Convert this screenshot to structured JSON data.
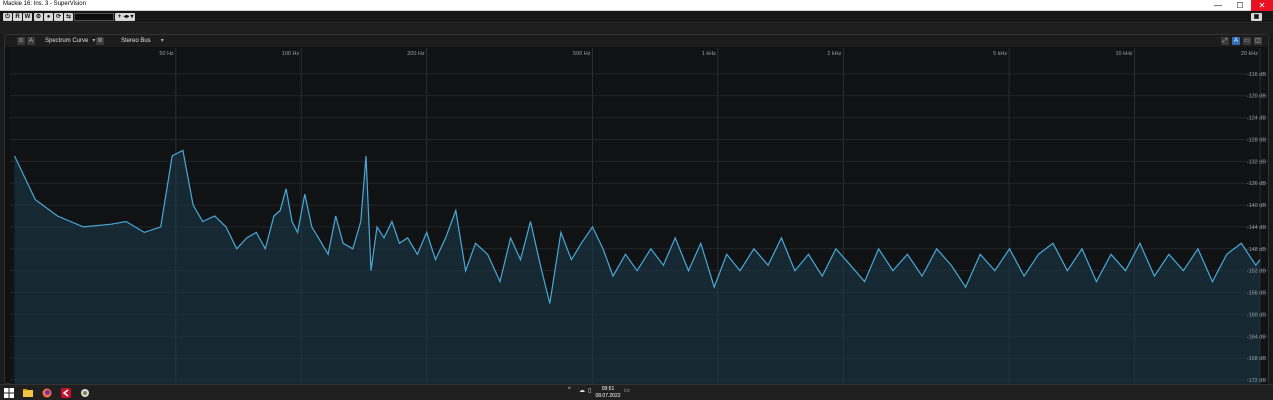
{
  "window": {
    "title": "Mackie 16: Ins. 3 - SuperVision",
    "minimize": "—",
    "maximize": "☐",
    "close": "✕"
  },
  "toolbar": {
    "power": "⏻",
    "read": "R",
    "write": "W",
    "settings": "⚙",
    "rec": "●",
    "preset_browser": "⟳",
    "compare": "⇆",
    "preset_name": "",
    "add": "+",
    "nav": "◂▸",
    "menu": "▾",
    "camera": "▣"
  },
  "panel": {
    "power": "⊙",
    "auto": "A",
    "module": "Spectrum Curve",
    "settings": "⚙",
    "source": "Stereo Bus",
    "right_buttons": [
      "⤢",
      "A",
      "▭",
      "◫"
    ]
  },
  "chart_data": {
    "type": "area",
    "x_scale": "log",
    "xlim": [
      20,
      20000
    ],
    "ylim": [
      -172,
      -112
    ],
    "x_ticks": [
      {
        "value": 50,
        "label": "50 Hz"
      },
      {
        "value": 100,
        "label": "100 Hz"
      },
      {
        "value": 200,
        "label": "200 Hz"
      },
      {
        "value": 500,
        "label": "500 Hz"
      },
      {
        "value": 1000,
        "label": "1 kHz"
      },
      {
        "value": 2000,
        "label": "2 kHz"
      },
      {
        "value": 5000,
        "label": "5 kHz"
      },
      {
        "value": 10000,
        "label": "10 kHz"
      },
      {
        "value": 20000,
        "label": "20 kHz"
      }
    ],
    "y_ticks": [
      {
        "value": -116,
        "label": "-116 dB"
      },
      {
        "value": -120,
        "label": "-120 dB"
      },
      {
        "value": -124,
        "label": "-124 dB"
      },
      {
        "value": -128,
        "label": "-128 dB"
      },
      {
        "value": -132,
        "label": "-132 dB"
      },
      {
        "value": -136,
        "label": "-136 dB"
      },
      {
        "value": -140,
        "label": "-140 dB"
      },
      {
        "value": -144,
        "label": "-144 dB"
      },
      {
        "value": -148,
        "label": "-148 dB"
      },
      {
        "value": -152,
        "label": "-152 dB"
      },
      {
        "value": -156,
        "label": "-156 dB"
      },
      {
        "value": -160,
        "label": "-160 dB"
      },
      {
        "value": -164,
        "label": "-164 dB"
      },
      {
        "value": -168,
        "label": "-168 dB"
      },
      {
        "value": -172,
        "label": "-172 dB"
      }
    ],
    "grid": true,
    "line_color": "#4aa8d8",
    "fill_color": "#1b3a4a",
    "peaks": [
      {
        "x": 20.5,
        "y": -131
      },
      {
        "x": 23,
        "y": -139
      },
      {
        "x": 26,
        "y": -142
      },
      {
        "x": 30,
        "y": -144
      },
      {
        "x": 35,
        "y": -143.5
      },
      {
        "x": 38,
        "y": -143
      },
      {
        "x": 42,
        "y": -145
      },
      {
        "x": 46,
        "y": -144
      },
      {
        "x": 49,
        "y": -131
      },
      {
        "x": 52,
        "y": -130
      },
      {
        "x": 55,
        "y": -140
      },
      {
        "x": 58,
        "y": -143
      },
      {
        "x": 62,
        "y": -142
      },
      {
        "x": 66,
        "y": -144
      },
      {
        "x": 70,
        "y": -148
      },
      {
        "x": 74,
        "y": -146
      },
      {
        "x": 78,
        "y": -145
      },
      {
        "x": 82,
        "y": -148
      },
      {
        "x": 86,
        "y": -142
      },
      {
        "x": 89,
        "y": -141
      },
      {
        "x": 92,
        "y": -137
      },
      {
        "x": 95,
        "y": -143
      },
      {
        "x": 98,
        "y": -145
      },
      {
        "x": 102,
        "y": -138
      },
      {
        "x": 106,
        "y": -144
      },
      {
        "x": 110,
        "y": -146
      },
      {
        "x": 116,
        "y": -149
      },
      {
        "x": 121,
        "y": -142
      },
      {
        "x": 126,
        "y": -147
      },
      {
        "x": 133,
        "y": -148
      },
      {
        "x": 139,
        "y": -143
      },
      {
        "x": 143,
        "y": -131
      },
      {
        "x": 147,
        "y": -152
      },
      {
        "x": 152,
        "y": -144
      },
      {
        "x": 158,
        "y": -146
      },
      {
        "x": 165,
        "y": -143
      },
      {
        "x": 172,
        "y": -147
      },
      {
        "x": 180,
        "y": -146
      },
      {
        "x": 190,
        "y": -149
      },
      {
        "x": 200,
        "y": -145
      },
      {
        "x": 210,
        "y": -150
      },
      {
        "x": 222,
        "y": -146
      },
      {
        "x": 235,
        "y": -141
      },
      {
        "x": 248,
        "y": -152
      },
      {
        "x": 262,
        "y": -147
      },
      {
        "x": 280,
        "y": -149
      },
      {
        "x": 300,
        "y": -154
      },
      {
        "x": 318,
        "y": -146
      },
      {
        "x": 336,
        "y": -150
      },
      {
        "x": 355,
        "y": -143
      },
      {
        "x": 375,
        "y": -151
      },
      {
        "x": 395,
        "y": -158
      },
      {
        "x": 420,
        "y": -145
      },
      {
        "x": 445,
        "y": -150
      },
      {
        "x": 470,
        "y": -147
      },
      {
        "x": 500,
        "y": -144
      },
      {
        "x": 530,
        "y": -148
      },
      {
        "x": 560,
        "y": -153
      },
      {
        "x": 600,
        "y": -149
      },
      {
        "x": 640,
        "y": -152
      },
      {
        "x": 690,
        "y": -148
      },
      {
        "x": 740,
        "y": -151
      },
      {
        "x": 790,
        "y": -146
      },
      {
        "x": 850,
        "y": -152
      },
      {
        "x": 910,
        "y": -147
      },
      {
        "x": 980,
        "y": -155
      },
      {
        "x": 1050,
        "y": -149
      },
      {
        "x": 1130,
        "y": -152
      },
      {
        "x": 1220,
        "y": -148
      },
      {
        "x": 1320,
        "y": -151
      },
      {
        "x": 1420,
        "y": -146
      },
      {
        "x": 1530,
        "y": -152
      },
      {
        "x": 1650,
        "y": -149
      },
      {
        "x": 1780,
        "y": -153
      },
      {
        "x": 1920,
        "y": -148
      },
      {
        "x": 2080,
        "y": -151
      },
      {
        "x": 2250,
        "y": -154
      },
      {
        "x": 2430,
        "y": -148
      },
      {
        "x": 2630,
        "y": -152
      },
      {
        "x": 2850,
        "y": -149
      },
      {
        "x": 3090,
        "y": -153
      },
      {
        "x": 3350,
        "y": -148
      },
      {
        "x": 3630,
        "y": -151
      },
      {
        "x": 3930,
        "y": -155
      },
      {
        "x": 4260,
        "y": -149
      },
      {
        "x": 4620,
        "y": -152
      },
      {
        "x": 5010,
        "y": -148
      },
      {
        "x": 5430,
        "y": -153
      },
      {
        "x": 5880,
        "y": -149
      },
      {
        "x": 6370,
        "y": -147
      },
      {
        "x": 6900,
        "y": -152
      },
      {
        "x": 7480,
        "y": -148
      },
      {
        "x": 8100,
        "y": -154
      },
      {
        "x": 8780,
        "y": -149
      },
      {
        "x": 9510,
        "y": -152
      },
      {
        "x": 10300,
        "y": -147
      },
      {
        "x": 11160,
        "y": -153
      },
      {
        "x": 12090,
        "y": -149
      },
      {
        "x": 13100,
        "y": -152
      },
      {
        "x": 14190,
        "y": -148
      },
      {
        "x": 15370,
        "y": -154
      },
      {
        "x": 16650,
        "y": -149
      },
      {
        "x": 18040,
        "y": -147
      },
      {
        "x": 19540,
        "y": -151
      },
      {
        "x": 20000,
        "y": -150
      }
    ]
  },
  "taskbar": {
    "time": "09:51",
    "date": "08.07.2022"
  }
}
